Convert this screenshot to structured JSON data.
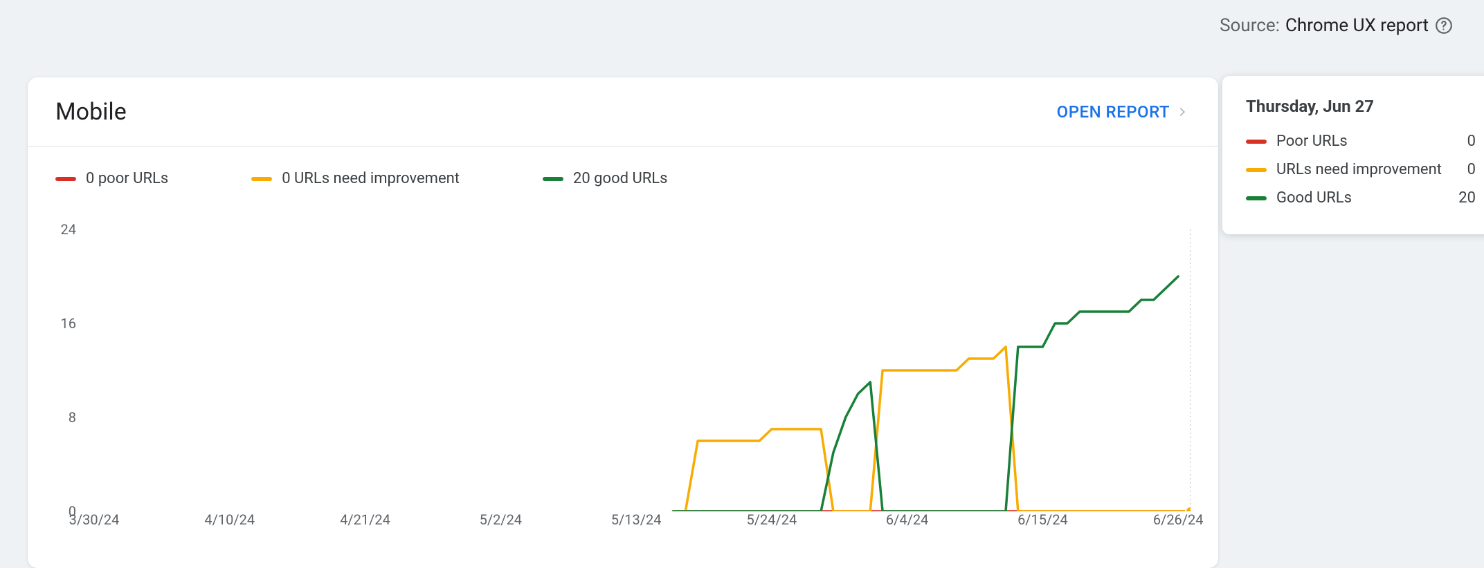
{
  "source": {
    "label": "Source:",
    "value": "Chrome UX report"
  },
  "card": {
    "title": "Mobile",
    "open_report": "OPEN REPORT",
    "legend": {
      "poor": "0 poor URLs",
      "need": "0 URLs need improvement",
      "good": "20 good URLs"
    }
  },
  "tooltip": {
    "title": "Thursday, Jun 27",
    "rows": {
      "poor_label": "Poor URLs",
      "poor_value": "0",
      "need_label": "URLs need improvement",
      "need_value": "0",
      "good_label": "Good URLs",
      "good_value": "20"
    }
  },
  "chart_data": {
    "type": "line",
    "title": "Mobile",
    "xlabel": "",
    "ylabel": "",
    "ylim": [
      0,
      24
    ],
    "y_ticks": [
      0,
      8,
      16,
      24
    ],
    "x_ticks": [
      "3/30/24",
      "4/10/24",
      "4/21/24",
      "5/2/24",
      "5/13/24",
      "5/24/24",
      "6/4/24",
      "6/15/24",
      "6/26/24"
    ],
    "x": [
      "3/30/24",
      "3/31/24",
      "4/1/24",
      "4/2/24",
      "4/3/24",
      "4/4/24",
      "4/5/24",
      "4/6/24",
      "4/7/24",
      "4/8/24",
      "4/9/24",
      "4/10/24",
      "4/11/24",
      "4/12/24",
      "4/13/24",
      "4/14/24",
      "4/15/24",
      "4/16/24",
      "4/17/24",
      "4/18/24",
      "4/19/24",
      "4/20/24",
      "4/21/24",
      "4/22/24",
      "4/23/24",
      "4/24/24",
      "4/25/24",
      "4/26/24",
      "4/27/24",
      "4/28/24",
      "4/29/24",
      "4/30/24",
      "5/1/24",
      "5/2/24",
      "5/3/24",
      "5/4/24",
      "5/5/24",
      "5/6/24",
      "5/7/24",
      "5/8/24",
      "5/9/24",
      "5/10/24",
      "5/11/24",
      "5/12/24",
      "5/13/24",
      "5/14/24",
      "5/15/24",
      "5/16/24",
      "5/17/24",
      "5/18/24",
      "5/19/24",
      "5/20/24",
      "5/21/24",
      "5/22/24",
      "5/23/24",
      "5/24/24",
      "5/25/24",
      "5/26/24",
      "5/27/24",
      "5/28/24",
      "5/29/24",
      "5/30/24",
      "5/31/24",
      "6/1/24",
      "6/2/24",
      "6/3/24",
      "6/4/24",
      "6/5/24",
      "6/6/24",
      "6/7/24",
      "6/8/24",
      "6/9/24",
      "6/10/24",
      "6/11/24",
      "6/12/24",
      "6/13/24",
      "6/14/24",
      "6/15/24",
      "6/16/24",
      "6/17/24",
      "6/18/24",
      "6/19/24",
      "6/20/24",
      "6/21/24",
      "6/22/24",
      "6/23/24",
      "6/24/24",
      "6/25/24",
      "6/26/24",
      "6/27/24"
    ],
    "series": [
      {
        "name": "Poor URLs",
        "color": "#d93025",
        "values": [
          null,
          null,
          null,
          null,
          null,
          null,
          null,
          null,
          null,
          null,
          null,
          null,
          null,
          null,
          null,
          null,
          null,
          null,
          null,
          null,
          null,
          null,
          null,
          null,
          null,
          null,
          null,
          null,
          null,
          null,
          null,
          null,
          null,
          null,
          null,
          null,
          null,
          null,
          null,
          null,
          null,
          null,
          null,
          null,
          null,
          null,
          null,
          0,
          0,
          0,
          0,
          0,
          0,
          0,
          0,
          0,
          0,
          0,
          0,
          0,
          0,
          0,
          0,
          0,
          0,
          0,
          0,
          0,
          0,
          0,
          0,
          0,
          0,
          0,
          0,
          0,
          0,
          0,
          0,
          0,
          0,
          0,
          0,
          0,
          0,
          0,
          0,
          0,
          0,
          0
        ]
      },
      {
        "name": "URLs need improvement",
        "color": "#f9ab00",
        "values": [
          null,
          null,
          null,
          null,
          null,
          null,
          null,
          null,
          null,
          null,
          null,
          null,
          null,
          null,
          null,
          null,
          null,
          null,
          null,
          null,
          null,
          null,
          null,
          null,
          null,
          null,
          null,
          null,
          null,
          null,
          null,
          null,
          null,
          null,
          null,
          null,
          null,
          null,
          null,
          null,
          null,
          null,
          null,
          null,
          null,
          null,
          null,
          0,
          0,
          6,
          6,
          6,
          6,
          6,
          6,
          7,
          7,
          7,
          7,
          7,
          0,
          0,
          0,
          0,
          12,
          12,
          12,
          12,
          12,
          12,
          12,
          13,
          13,
          13,
          14,
          0,
          0,
          0,
          0,
          0,
          0,
          0,
          0,
          0,
          0,
          0,
          0,
          0,
          0,
          0
        ]
      },
      {
        "name": "Good URLs",
        "color": "#188038",
        "values": [
          null,
          null,
          null,
          null,
          null,
          null,
          null,
          null,
          null,
          null,
          null,
          null,
          null,
          null,
          null,
          null,
          null,
          null,
          null,
          null,
          null,
          null,
          null,
          null,
          null,
          null,
          null,
          null,
          null,
          null,
          null,
          null,
          null,
          null,
          null,
          null,
          null,
          null,
          null,
          null,
          null,
          null,
          null,
          null,
          null,
          null,
          null,
          0,
          0,
          0,
          0,
          0,
          0,
          0,
          0,
          0,
          0,
          0,
          0,
          0,
          5,
          8,
          10,
          11,
          0,
          0,
          0,
          0,
          0,
          0,
          0,
          0,
          0,
          0,
          0,
          14,
          14,
          14,
          16,
          16,
          17,
          17,
          17,
          17,
          17,
          18,
          18,
          19,
          20
        ]
      }
    ],
    "hover_index": 89
  }
}
